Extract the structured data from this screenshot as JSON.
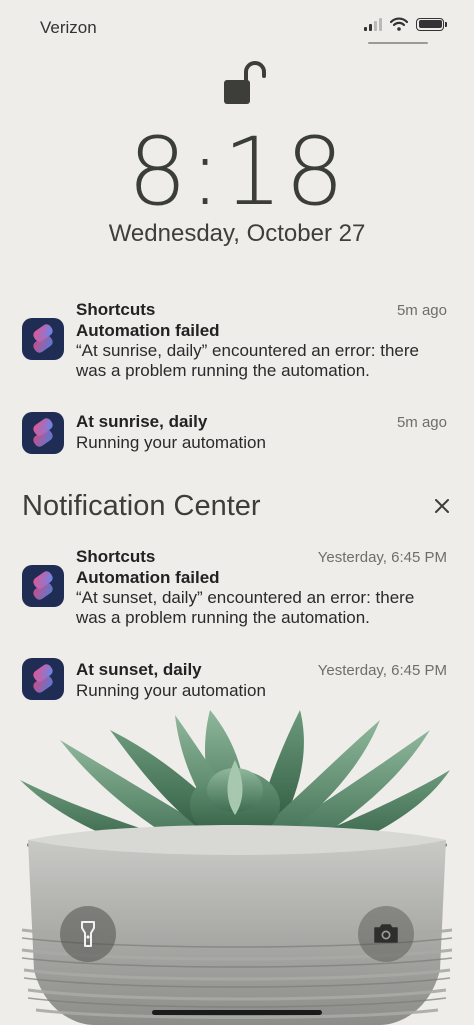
{
  "status_bar": {
    "carrier": "Verizon",
    "signal_bars_active": 2,
    "signal_bars_total": 4,
    "battery_level": 1.0
  },
  "lock_screen": {
    "lock_state": "unlocked",
    "time": "8:18",
    "date": "Wednesday, October 27"
  },
  "recent_notifications": [
    {
      "app": "Shortcuts",
      "title": "Automation failed",
      "message_line1": "“At sunrise, daily” encountered an error: there",
      "message_line2": "was a problem running the automation.",
      "time": "5m ago"
    },
    {
      "title": "At sunrise, daily",
      "message_line1": "Running your automation",
      "time": "5m ago"
    }
  ],
  "notification_center": {
    "header": "Notification Center",
    "items": [
      {
        "app": "Shortcuts",
        "title": "Automation failed",
        "message_line1": "“At sunset, daily” encountered an error: there",
        "message_line2": "was a problem running the automation.",
        "time": "Yesterday, 6:45 PM"
      },
      {
        "title": "At sunset, daily",
        "message_line1": "Running your automation",
        "time": "Yesterday, 6:45 PM"
      }
    ]
  },
  "quick_actions": {
    "left_icon": "flashlight-icon",
    "right_icon": "camera-icon"
  },
  "colors": {
    "background": "#eeedea",
    "shortcuts_icon_bg": "#1f2d55",
    "shortcuts_gradient_pink": "#f0508a",
    "shortcuts_gradient_blue": "#5a8cf0"
  }
}
